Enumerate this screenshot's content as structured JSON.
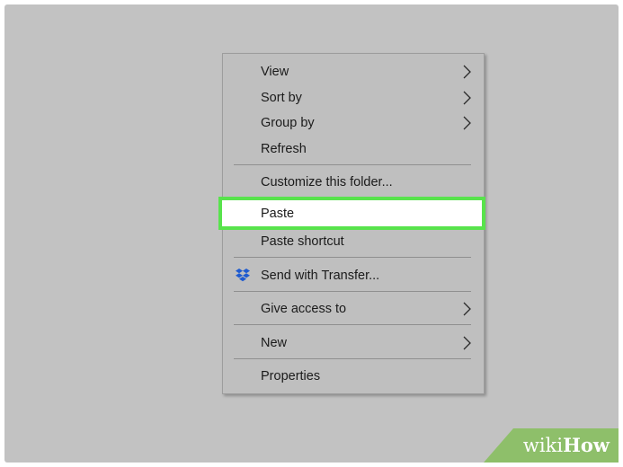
{
  "context_menu": {
    "items": [
      {
        "label": "View",
        "submenu": true
      },
      {
        "label": "Sort by",
        "submenu": true
      },
      {
        "label": "Group by",
        "submenu": true
      },
      {
        "label": "Refresh",
        "submenu": false
      },
      {
        "label": "Customize this folder...",
        "submenu": false
      },
      {
        "label": "Paste",
        "submenu": false,
        "highlighted": true
      },
      {
        "label": "Paste shortcut",
        "submenu": false
      },
      {
        "label": "Send with Transfer...",
        "submenu": false,
        "icon": "dropbox-icon"
      },
      {
        "label": "Give access to",
        "submenu": true
      },
      {
        "label": "New",
        "submenu": true
      },
      {
        "label": "Properties",
        "submenu": false
      }
    ]
  },
  "highlight_color": "#58e34c",
  "watermark": {
    "wiki": "wiki",
    "how": "How"
  }
}
